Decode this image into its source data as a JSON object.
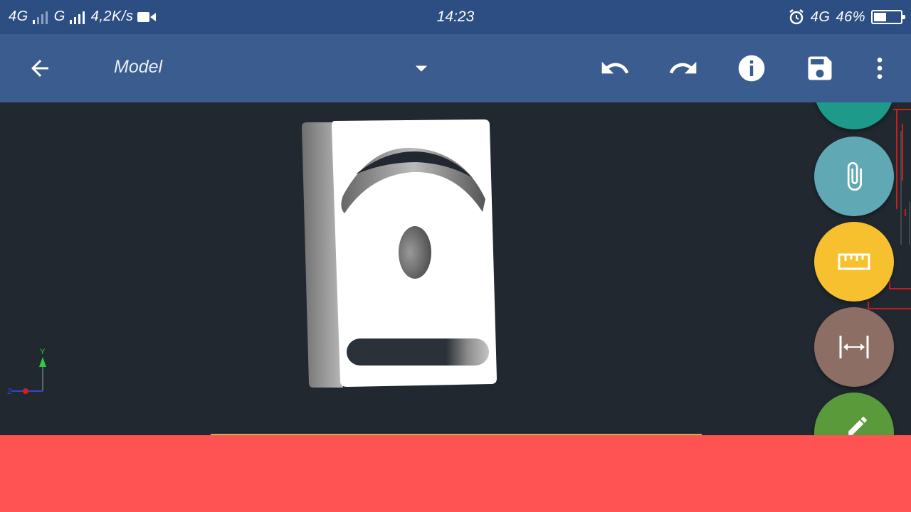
{
  "status_bar": {
    "network_1": "4G",
    "network_2": "G",
    "speed": "4,2K/s",
    "time": "14:23",
    "network_right": "4G",
    "battery": "46%",
    "battery_level": 0.46
  },
  "app_bar": {
    "title": "Model"
  },
  "axis": {
    "y_label": "Y",
    "z_label": "Z"
  },
  "icons": {
    "back": "arrow-left-icon",
    "dropdown": "caret-down-icon",
    "undo": "undo-icon",
    "redo": "redo-icon",
    "info": "info-icon",
    "save": "floppy-disk-icon",
    "more": "more-vert-icon",
    "attach": "paperclip-icon",
    "measure": "ruler-icon",
    "dimension": "dimension-icon",
    "edit": "pencil-icon"
  },
  "colors": {
    "status_bar": "#2d4e82",
    "app_bar": "#3a5c8f",
    "canvas": "#212830",
    "fab_teal": "#1e9a8a",
    "fab_cyan": "#5fa8b4",
    "fab_yellow": "#f6c02f",
    "fab_brown": "#8c6e64",
    "fab_green": "#5a9a3a",
    "bottom_panel": "#ff5252"
  }
}
